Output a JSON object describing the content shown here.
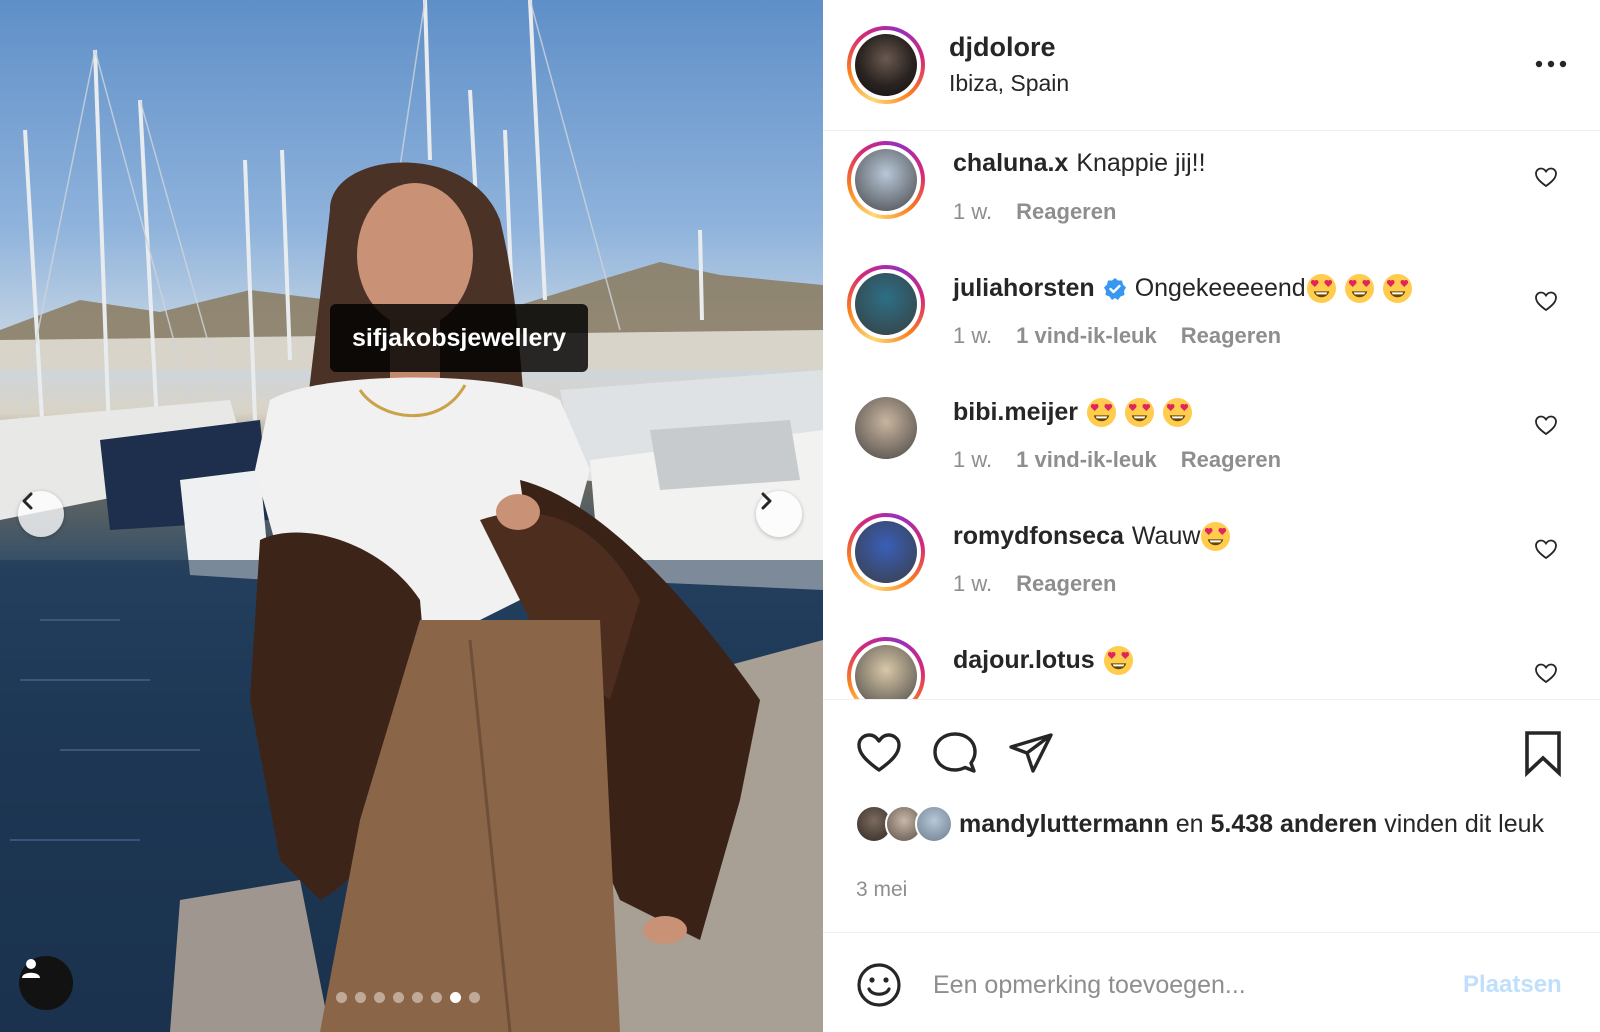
{
  "photo": {
    "tag_label": "sifjakobsjewellery",
    "carousel": {
      "total": 8,
      "active_index": 6
    }
  },
  "post": {
    "username": "djdolore",
    "location": "Ibiza, Spain"
  },
  "comments": [
    {
      "user": "chaluna.x",
      "text": "Knappie jij!!",
      "emojis": 0,
      "verified": false,
      "time": "1 w.",
      "likes": "",
      "reply": "Reageren",
      "story_ring": true,
      "avatar_color": "#b8c7d8"
    },
    {
      "user": "juliahorsten",
      "text": "Ongekeeeeend",
      "emojis": 3,
      "verified": true,
      "time": "1 w.",
      "likes": "1 vind-ik-leuk",
      "reply": "Reageren",
      "story_ring": true,
      "avatar_color": "#2c6f86"
    },
    {
      "user": "bibi.meijer",
      "text": "",
      "emojis": 3,
      "verified": false,
      "time": "1 w.",
      "likes": "1 vind-ik-leuk",
      "reply": "Reageren",
      "story_ring": false,
      "avatar_color": "#c9b59f"
    },
    {
      "user": "romydfonseca",
      "text": "Wauw",
      "emojis": 1,
      "verified": false,
      "time": "1 w.",
      "likes": "",
      "reply": "Reageren",
      "story_ring": true,
      "avatar_color": "#3a5fb8"
    },
    {
      "user": "dajour.lotus",
      "text": "",
      "emojis": 1,
      "verified": false,
      "time": "",
      "likes": "",
      "reply": "",
      "story_ring": true,
      "avatar_color": "#d9c8a8"
    }
  ],
  "likes": {
    "first_user": "mandyluttermann",
    "conj": "en",
    "others": "5.438 anderen",
    "suffix": "vinden dit leuk"
  },
  "date": "3 mei",
  "composer": {
    "placeholder": "Een opmerking toevoegen...",
    "post_label": "Plaatsen"
  },
  "icons": {
    "heart": "heart-icon",
    "comment": "comment-icon",
    "share": "share-icon",
    "save": "bookmark-icon",
    "emoji": "emoji-icon",
    "more": "more-icon"
  },
  "colors": {
    "text": "#262626",
    "muted": "#8e8e8e",
    "verified": "#3897f0",
    "post_disabled": "#c0dffd"
  }
}
